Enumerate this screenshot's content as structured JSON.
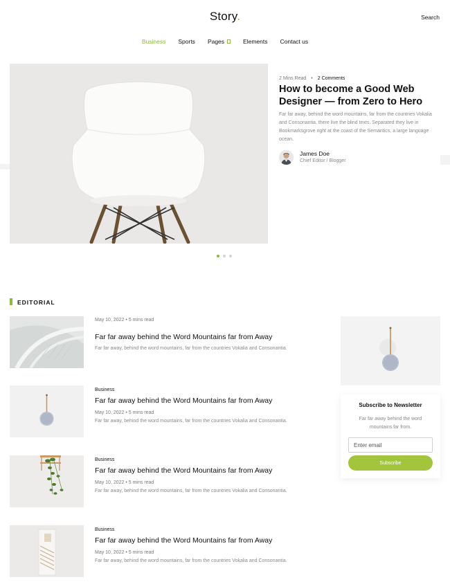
{
  "header": {
    "logo": "Story",
    "logo_dot": ".",
    "search_label": "Search"
  },
  "nav": {
    "items": [
      {
        "label": "Business"
      },
      {
        "label": "Sports"
      },
      {
        "label": "Pages"
      },
      {
        "label": "Elements"
      },
      {
        "label": "Contact us"
      }
    ],
    "active_color": "#8bb93a"
  },
  "hero": {
    "read_time": "2 Mins Read",
    "separator": "•",
    "comments": "2 Comments",
    "title": "How to become a Good Web Designer — from Zero to Hero",
    "excerpt": "Far far away, behind the word mountains, far from the countries Vokalia and Consonantia, there live the blind texts. Separated they live in Bookmarksgrove right at the coast of the Semantics, a large language ocean.",
    "author_name": "James Doe",
    "author_role": "Chief Editor / Blogger",
    "slider_dots": 3,
    "active_dot": 0
  },
  "editorial": {
    "title": "EDITORIAL",
    "posts": [
      {
        "category": "",
        "date": "May 10, 2022 • 5 mins read",
        "title": "Far far away behind the Word Mountains far from Away",
        "excerpt": "Far far away, behind the word mountains, far from the countries Vokalia and Consonantia."
      },
      {
        "category": "Business",
        "date": "May 10, 2022 • 5 mins read",
        "title": "Far far away behind the Word Mountains far from Away",
        "excerpt": "Far far away, behind the word mountains, far from the countries Vokalia and Consonantia."
      },
      {
        "category": "Business",
        "date": "May 10, 2022 • 5 mins read",
        "title": "Far far away behind the Word Mountains far from Away",
        "excerpt": "Far far away, behind the word mountains, far from the countries Vokalia and Consonantia."
      },
      {
        "category": "Business",
        "date": "May 10, 2022 • 5 mins read",
        "title": "Far far away behind the Word Mountains far from Away",
        "excerpt": "Far far away, behind the word mountains, far from the countries Vokalia and Consonantia."
      }
    ]
  },
  "newsletter": {
    "title": "Subscribe to Newsletter",
    "text": "Far far away behind the word mountains far from.",
    "email_placeholder": "Enter email",
    "button_label": "Subscribe"
  },
  "colors": {
    "accent": "#8bb93a",
    "button": "#a3c53d"
  }
}
